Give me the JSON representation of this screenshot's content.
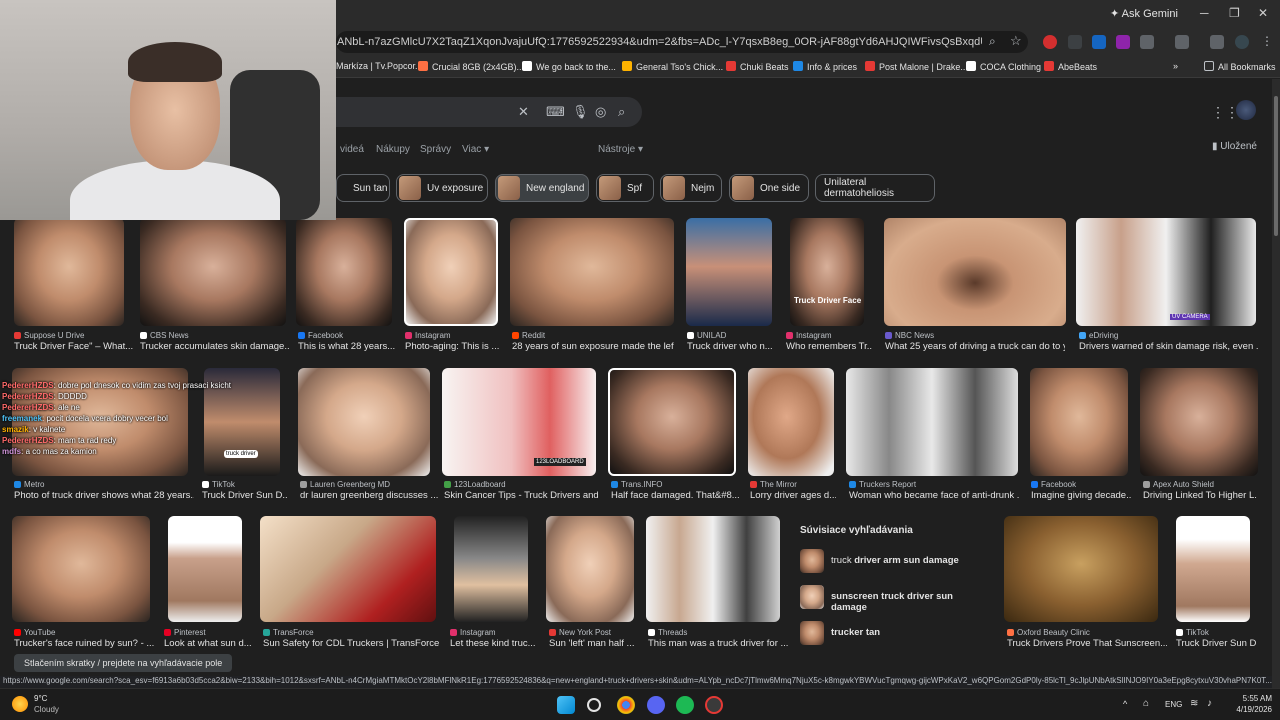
{
  "browser": {
    "ask_gemini": "Ask Gemini",
    "url": "ANbL-n7azGMlcU7X2TaqZ1XqonJvajuUfQ:1776592522934&udm=2&fbs=ADc_l-Y7qsxB8eg_0OR-jAF88gtYd6AHJQIWFivsQsBxqdUKzIYBYF_6Yn-_LO0r8yRzN...",
    "bookmarks": [
      {
        "label": "Markíza | Tv.Popcor...",
        "color": "#e53935"
      },
      {
        "label": "Crucial 8GB (2x4GB)...",
        "color": "#ff7043"
      },
      {
        "label": "We go back to the...",
        "color": "#ffffff"
      },
      {
        "label": "General Tso's Chick...",
        "color": "#ffb300"
      },
      {
        "label": "Chuki Beats",
        "color": "#e53935"
      },
      {
        "label": "Info & prices",
        "color": "#1e88e5"
      },
      {
        "label": "Post Malone | Drake...",
        "color": "#e53935"
      },
      {
        "label": "COCA Clothing",
        "color": "#ffffff"
      },
      {
        "label": "AbeBeats",
        "color": "#e53935"
      }
    ],
    "all_bookmarks": "All Bookmarks"
  },
  "search": {
    "tabs": [
      "videá",
      "Nákupy",
      "Správy",
      "Viac"
    ],
    "tools": "Nástroje",
    "saved": "Uložené",
    "chips": [
      "Sun tan",
      "Uv exposure",
      "New england",
      "Spf",
      "Nejm",
      "One side",
      "Unilateral dermatoheliosis"
    ]
  },
  "row1": [
    {
      "source": "Suppose U Drive",
      "caption": "Truck Driver Face\" – What...",
      "color": "#e53935"
    },
    {
      "source": "CBS News",
      "caption": "Trucker accumulates skin damage...",
      "color": "#ffffff"
    },
    {
      "source": "Facebook",
      "caption": "This is what 28 years...",
      "color": "#1877f2"
    },
    {
      "source": "Instagram",
      "caption": "Photo-aging: This is ...",
      "color": "#e1306c"
    },
    {
      "source": "Reddit",
      "caption": "28 years of sun exposure made the lef...",
      "color": "#ff4500"
    },
    {
      "source": "UNILAD",
      "caption": "Truck driver who n...",
      "color": "#ffffff"
    },
    {
      "source": "Instagram",
      "caption": "Who remembers Tr...",
      "color": "#e1306c"
    },
    {
      "source": "NBC News",
      "caption": "What 25 years of driving a truck can do to y...",
      "color": "#6a5acd"
    },
    {
      "source": "eDriving",
      "caption": "Drivers warned of skin damage risk, even ...",
      "color": "#42a5f5"
    }
  ],
  "row1_overlay_texts": [
    "Truck Driver Face",
    "UV CAMERA"
  ],
  "row2": [
    {
      "source": "Metro",
      "caption": "Photo of truck driver shows what 28 years...",
      "color": "#1e88e5"
    },
    {
      "source": "TikTok",
      "caption": "Truck Driver Sun D...",
      "color": "#ffffff"
    },
    {
      "source": "Lauren Greenberg MD",
      "caption": "dr lauren greenberg discusses ...",
      "color": "#9e9e9e"
    },
    {
      "source": "123Loadboard",
      "caption": "Skin Cancer Tips - Truck Drivers and...",
      "color": "#43a047"
    },
    {
      "source": "Trans.INFO",
      "caption": "Half face damaged. That&#8...",
      "color": "#1e88e5"
    },
    {
      "source": "The Mirror",
      "caption": "Lorry driver ages d...",
      "color": "#e53935"
    },
    {
      "source": "Truckers Report",
      "caption": "Woman who became face of anti-drunk ...",
      "color": "#1e88e5"
    },
    {
      "source": "Facebook",
      "caption": "Imagine giving decade...",
      "color": "#1877f2"
    },
    {
      "source": "Apex Auto Shield",
      "caption": "Driving Linked To Higher L...",
      "color": "#9e9e9e"
    }
  ],
  "row2_overlay_texts": [
    "123LOADBOARD",
    "truck driver"
  ],
  "row3": [
    {
      "source": "YouTube",
      "caption": "Trucker's face ruined by sun? - ...",
      "color": "#ff0000"
    },
    {
      "source": "Pinterest",
      "caption": "Look at what sun d...",
      "color": "#e60023"
    },
    {
      "source": "TransForce",
      "caption": "Sun Safety for CDL Truckers | TransForce",
      "color": "#26a69a"
    },
    {
      "source": "Instagram",
      "caption": "Let these kind truc...",
      "color": "#e1306c"
    },
    {
      "source": "New York Post",
      "caption": "Sun 'left' man half ...",
      "color": "#e53935"
    },
    {
      "source": "Threads",
      "caption": "This man was a truck driver for ...",
      "color": "#ffffff"
    },
    {
      "source": "Oxford Beauty Clinic",
      "caption": "Truck Drivers Prove That Sunscreen...",
      "color": "#ff7043"
    },
    {
      "source": "TikTok",
      "caption": "Truck Driver Sun D...",
      "color": "#ffffff"
    }
  ],
  "related": {
    "title": "Súvisiace vyhľadávania",
    "items": [
      {
        "pre": "truck ",
        "bold": "driver arm sun damage"
      },
      {
        "pre": "",
        "bold": "sunscreen truck driver sun damage"
      },
      {
        "pre": "",
        "bold": "trucker tan"
      }
    ]
  },
  "chat": [
    {
      "user": "PedererHZDS",
      "text": ": dobre pol dnesok co vidim zas tvoj prasaci ksicht"
    },
    {
      "user": "PedererHZDS",
      "text": ": DDDDD"
    },
    {
      "user": "PedererHZDS",
      "text": ": ale ne"
    },
    {
      "user": "freemanek",
      "text": ": pocit docela vcera dobry vecer bol"
    },
    {
      "user": "smazik",
      "text": ": v kalnete"
    },
    {
      "user": "PedererHZDS",
      "text": ": mam ta rad redy"
    },
    {
      "user": "mdfs",
      "text": ": a co mas za kamion"
    }
  ],
  "shortcut_hint": "Stlačením skratky / prejdete na vyhľadávacie pole",
  "status_url": "https://www.google.com/search?sca_esv=f6913a6b03d5cca2&biw=2133&bih=1012&sxsrf=ANbL-n4CrMgiaMTMktOcY2l8bMFlNkR1Eg:1776592524836&q=new+england+truck+drivers+skin&udm=ALYpb_ncDc7jTlmw6Mmq7NjuX5c-k8mgwkYBWVucTgmqwg-gijcWPxKaV2_w6QPGom2GdP0ly-85lcTl_9cJlpUNbAtkSlINJO9IY0a3eEpg8cytxuV30vhaPN7K0T...",
  "taskbar": {
    "temp": "9°C",
    "weather": "Cloudy",
    "lang": "ENG",
    "time": "5:55 AM",
    "date": "4/19/2026"
  }
}
